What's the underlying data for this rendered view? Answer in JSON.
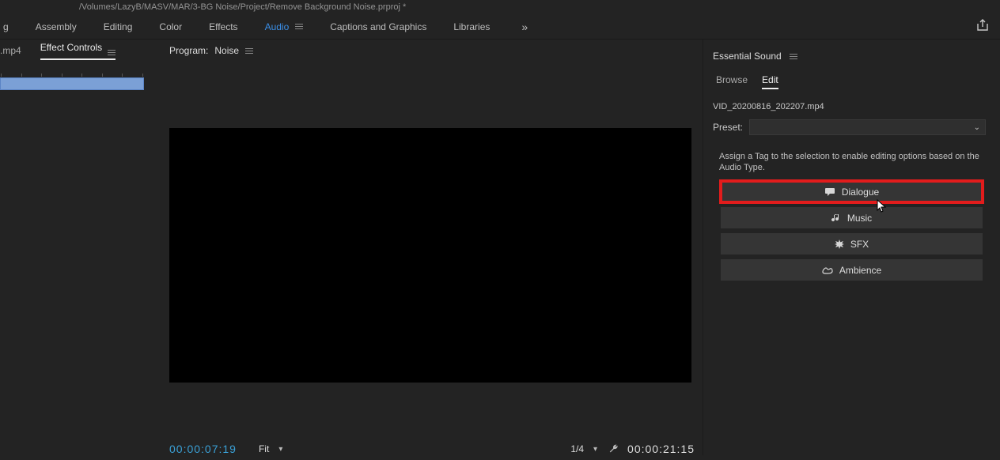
{
  "title_bar": {
    "path": "/Volumes/LazyB/MASV/MAR/3-BG Noise/Project/Remove Background Noise.prproj *"
  },
  "workspaces": {
    "items": [
      "g",
      "Assembly",
      "Editing",
      "Color",
      "Effects",
      "Audio",
      "Captions and Graphics",
      "Libraries"
    ],
    "active_index": 5,
    "more_glyph": "»"
  },
  "left_panel": {
    "tabs": [
      ".mp4",
      "Effect Controls"
    ],
    "active_index": 1
  },
  "program": {
    "header_label": "Program:",
    "sequence_name": "Noise",
    "timecode_left": "00:00:07:19",
    "fit_label": "Fit",
    "zoom_label": "1/4",
    "timecode_right": "00:00:21:15"
  },
  "essential_sound": {
    "panel_title": "Essential Sound",
    "tabs": [
      "Browse",
      "Edit"
    ],
    "active_tab": 1,
    "clip_name": "VID_20200816_202207.mp4",
    "preset_label": "Preset:",
    "assign_text": "Assign a Tag to the selection to enable editing options based on the Audio Type.",
    "tags": [
      {
        "icon": "dialogue-icon",
        "label": "Dialogue"
      },
      {
        "icon": "music-icon",
        "label": "Music"
      },
      {
        "icon": "sfx-icon",
        "label": "SFX"
      },
      {
        "icon": "ambience-icon",
        "label": "Ambience"
      }
    ],
    "highlighted_tag_index": 0
  }
}
